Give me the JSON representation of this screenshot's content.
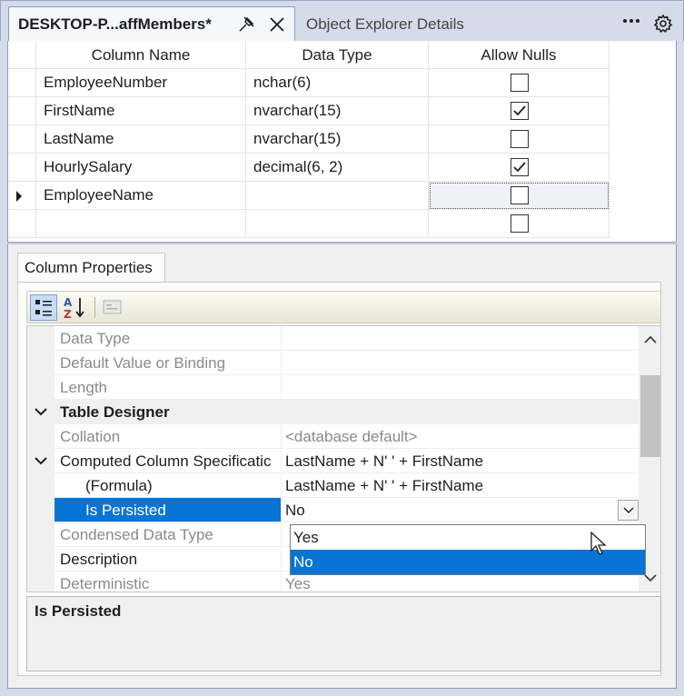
{
  "tabs": {
    "active_title": "DESKTOP-P...affMembers*",
    "inactive_title": "Object Explorer Details"
  },
  "grid": {
    "headers": [
      "Column Name",
      "Data Type",
      "Allow Nulls"
    ],
    "rows": [
      {
        "name": "EmployeeNumber",
        "type": "nchar(6)",
        "allow_nulls": false
      },
      {
        "name": "FirstName",
        "type": "nvarchar(15)",
        "allow_nulls": true
      },
      {
        "name": "LastName",
        "type": "nvarchar(15)",
        "allow_nulls": false
      },
      {
        "name": "HourlySalary",
        "type": "decimal(6, 2)",
        "allow_nulls": true
      },
      {
        "name": "EmployeeName",
        "type": "",
        "allow_nulls": false,
        "current": true
      },
      {
        "name": "",
        "type": "",
        "allow_nulls": false
      }
    ]
  },
  "column_properties": {
    "tab_label": "Column Properties",
    "rows": [
      {
        "name": "Data Type",
        "value": "",
        "kind": "muted"
      },
      {
        "name": "Default Value or Binding",
        "value": "",
        "kind": "muted"
      },
      {
        "name": "Length",
        "value": "",
        "kind": "muted"
      },
      {
        "name": "Table Designer",
        "value": "",
        "kind": "category"
      },
      {
        "name": "Collation",
        "value": "<database default>",
        "kind": "muted"
      },
      {
        "name": "Computed Column Specificatic",
        "value": "LastName + N' ' + FirstName",
        "kind": "expandable"
      },
      {
        "name": "(Formula)",
        "value": "LastName + N' ' + FirstName",
        "kind": "child"
      },
      {
        "name": "Is Persisted",
        "value": "No",
        "kind": "selected"
      },
      {
        "name": "Condensed Data Type",
        "value": "",
        "kind": "muted"
      },
      {
        "name": "Description",
        "value": "",
        "kind": "normal"
      },
      {
        "name": "Deterministic",
        "value": "Yes",
        "kind": "muted"
      }
    ],
    "dropdown_options": [
      "Yes",
      "No"
    ],
    "dropdown_highlighted": "No",
    "description_title": "Is Persisted"
  },
  "colors": {
    "selection": "#0a74d4",
    "panel_bg": "#d6dbe9"
  }
}
